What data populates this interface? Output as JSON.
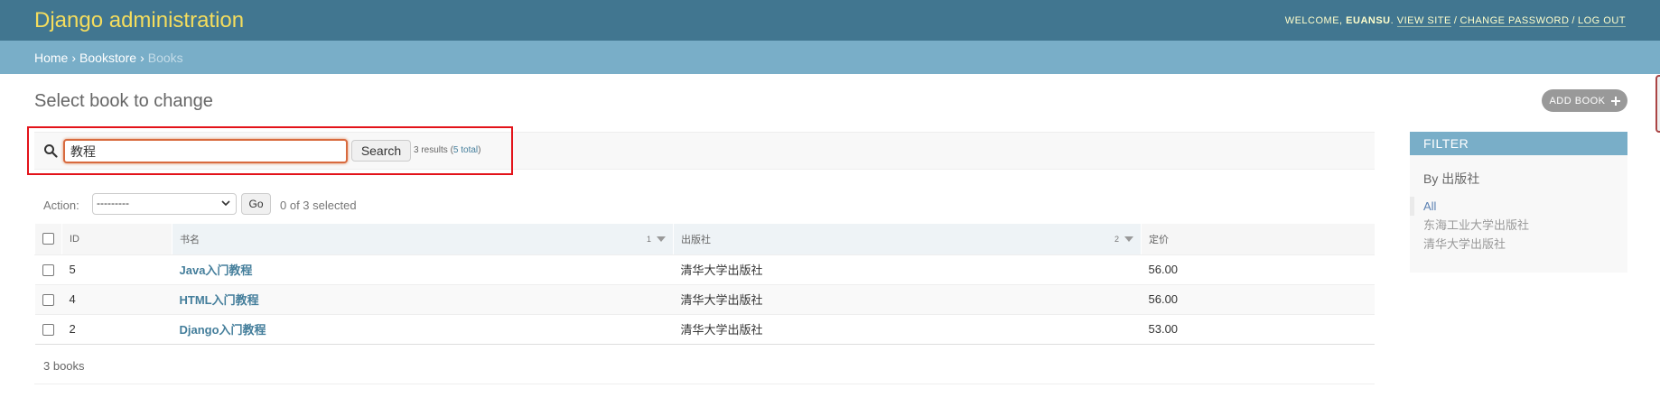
{
  "header": {
    "branding": "Django administration",
    "welcome": "WELCOME,",
    "username": "EUANSU",
    "view_site": "VIEW SITE",
    "change_password": "CHANGE PASSWORD",
    "log_out": "LOG OUT",
    "separator": "/"
  },
  "breadcrumbs": {
    "home": "Home",
    "app": "Bookstore",
    "current": "Books",
    "separator": "›"
  },
  "page": {
    "title": "Select book to change",
    "add_button": "ADD BOOK"
  },
  "search": {
    "value": "教程",
    "button": "Search",
    "results_prefix": "3 results (",
    "results_total": "5 total",
    "results_suffix": ")"
  },
  "actions": {
    "label": "Action:",
    "selected_value": "---------",
    "go": "Go",
    "counter": "0 of 3 selected"
  },
  "table": {
    "columns": [
      {
        "label": "ID"
      },
      {
        "label": "书名",
        "sort_priority": "1"
      },
      {
        "label": "出版社",
        "sort_priority": "2"
      },
      {
        "label": "定价"
      }
    ],
    "rows": [
      {
        "id": "5",
        "name": "Java入门教程",
        "publisher": "清华大学出版社",
        "price": "56.00"
      },
      {
        "id": "4",
        "name": "HTML入门教程",
        "publisher": "清华大学出版社",
        "price": "56.00"
      },
      {
        "id": "2",
        "name": "Django入门教程",
        "publisher": "清华大学出版社",
        "price": "53.00"
      }
    ]
  },
  "paginator": "3 books",
  "filter": {
    "title": "FILTER",
    "subtitle": "By 出版社",
    "items": [
      {
        "label": "All",
        "selected": true
      },
      {
        "label": "东海工业大学出版社",
        "selected": false
      },
      {
        "label": "清华大学出版社",
        "selected": false
      }
    ]
  },
  "colors": {
    "header": "#417690",
    "breadcrumbs": "#79aec8",
    "branding": "#f5dd5d",
    "link": "#447e9b",
    "highlight_box": "#e3131a"
  }
}
